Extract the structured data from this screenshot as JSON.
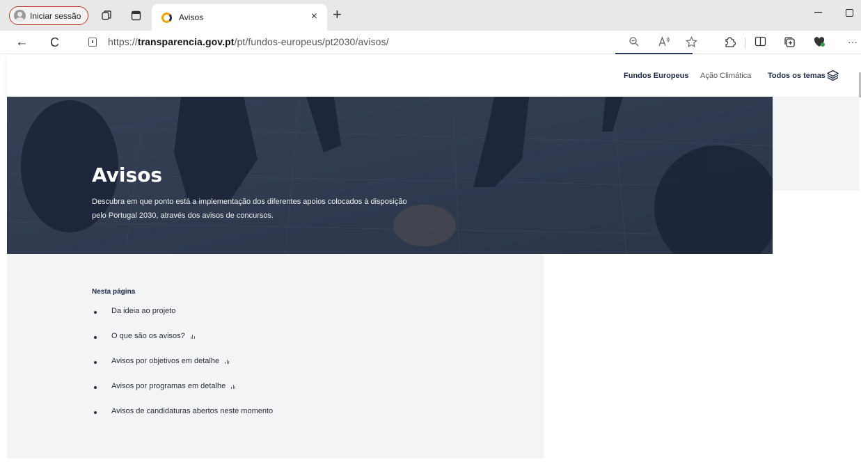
{
  "browser": {
    "profile_label": "Iniciar sessão",
    "tab_title": "Avisos",
    "tab_close": "×",
    "new_tab": "+",
    "minimize": "–",
    "url_prefix": "https://",
    "url_domain": "transparencia.gov.pt",
    "url_path": "/pt/fundos-europeus/pt2030/avisos/",
    "back": "←",
    "refresh": "C",
    "more": "···"
  },
  "site": {
    "nav": {
      "fundos": "Fundos Europeus",
      "acao": "Ação Climática",
      "todos": "Todos os temas"
    },
    "hero": {
      "title": "Avisos",
      "description": "Descubra em que ponto está a implementação dos diferentes apoios colocados à disposição pelo Portugal 2030, através dos avisos de concursos."
    },
    "toc": {
      "heading": "Nesta página",
      "items": [
        {
          "label": "Da ideia ao projeto",
          "chart": false
        },
        {
          "label": "O que são os avisos?",
          "chart": true
        },
        {
          "label": "Avisos por objetivos em detalhe",
          "chart": true
        },
        {
          "label": "Avisos por programas em detalhe",
          "chart": true
        },
        {
          "label": "Avisos de candidaturas abertos neste momento",
          "chart": false
        }
      ]
    }
  },
  "colors": {
    "navy": "#1e2b45",
    "grey_bg": "#f3f4f6",
    "profile_outline": "#c0392b",
    "favicon_ring": "#f0a500"
  }
}
